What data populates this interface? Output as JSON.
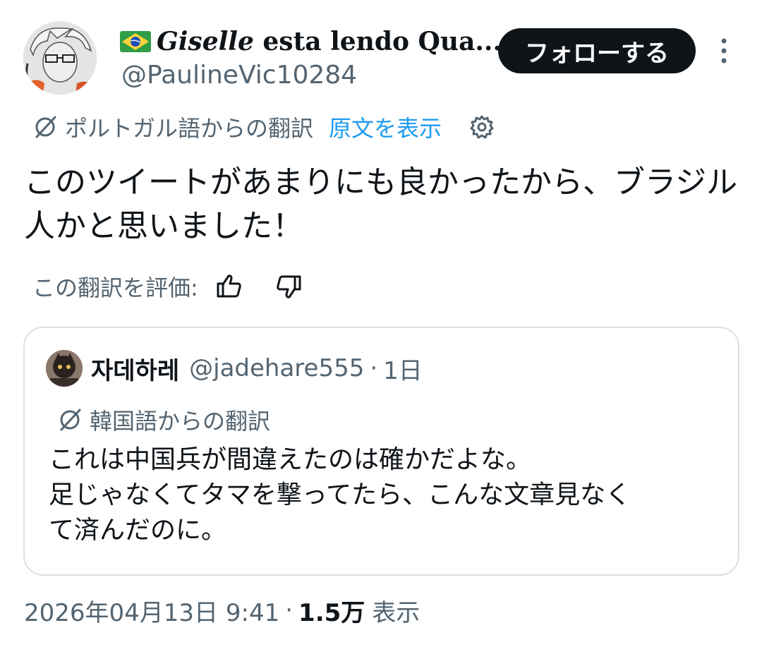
{
  "author": {
    "display_name_first": "Giselle",
    "display_name_rest": "esta lendo Qua...",
    "handle": "@PaulineVic10284"
  },
  "follow_button_label": "フォローする",
  "translation": {
    "label": "ポルトガル語からの翻訳",
    "show_original_label": "原文を表示"
  },
  "tweet_text": "このツイートがあまりにも良かったから、ブラジル人かと思いました！",
  "rate": {
    "label": "この翻訳を評価:"
  },
  "quote": {
    "name": "자데하레",
    "handle": "@jadehare555",
    "separator": "·",
    "time": "1日",
    "translation_label": "韓国語からの翻訳",
    "text_lines": [
      "これは中国兵が間違えたのは確かだよな。",
      "足じゃなくてタマを撃ってたら、こんな文章見なく",
      "て済んだのに。"
    ]
  },
  "footer": {
    "date": "2026年04月13日 9:41",
    "separator": "·",
    "views_count": "1.5万",
    "views_label": "表示"
  },
  "colors": {
    "text": "#0f1419",
    "secondary": "#536471",
    "link": "#1d9bf0",
    "button_bg": "#0f1419",
    "border": "#dadfe3"
  },
  "icons": [
    "brazil-flag-icon",
    "translate-icon",
    "gear-icon",
    "thumbs-up-icon",
    "thumbs-down-icon",
    "more-dots-icon"
  ]
}
